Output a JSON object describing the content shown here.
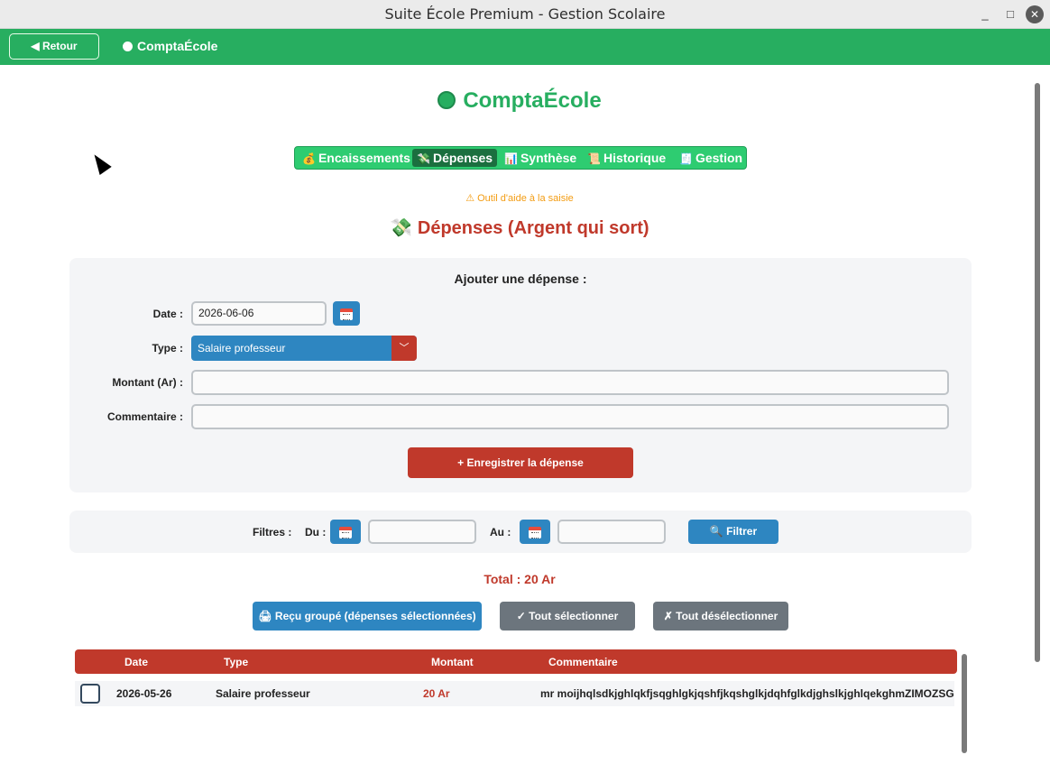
{
  "window": {
    "title": "Suite École Premium - Gestion Scolaire",
    "min": "_",
    "max": "□",
    "close": "✕"
  },
  "appbar": {
    "back_label": "◀ Retour",
    "title": "ComptaÉcole"
  },
  "header": {
    "title": "ComptaÉcole",
    "accent": "#27ae60"
  },
  "tabs": [
    {
      "icon": "💰",
      "label": "Encaissements"
    },
    {
      "icon": "💸",
      "label": "Dépenses",
      "active": true
    },
    {
      "icon": "📊",
      "label": "Synthèse"
    },
    {
      "icon": "📜",
      "label": "Historique"
    },
    {
      "icon": "🧾",
      "label": "Gestion"
    }
  ],
  "warning": "⚠ Outil d'aide à la saisie",
  "section": {
    "icon": "💸",
    "title": "Dépenses (Argent qui sort)"
  },
  "form": {
    "title": "Ajouter une dépense :",
    "date_label": "Date :",
    "date_value": "2026-06-06",
    "type_label": "Type :",
    "type_value": "Salaire professeur",
    "amount_label": "Montant (Ar) :",
    "amount_value": "",
    "comment_label": "Commentaire :",
    "comment_value": "",
    "save_label": "+ Enregistrer la dépense"
  },
  "filters": {
    "label": "Filtres :",
    "from_label": "Du :",
    "from_value": "",
    "to_label": "Au :",
    "to_value": "",
    "button_label": "🔍 Filtrer"
  },
  "total": "Total : 20 Ar",
  "actions": {
    "grouped_receipt": "🖨 Reçu groupé (dépenses sélectionnées)",
    "select_all": "✓ Tout sélectionner",
    "deselect_all": "✗ Tout désélectionner"
  },
  "table": {
    "headers": [
      "Date",
      "Type",
      "Montant",
      "Commentaire"
    ],
    "rows": [
      {
        "date": "2026-05-26",
        "type": "Salaire professeur",
        "amount": "20 Ar",
        "comment": "mr moijhqlsdkjghlqkfjsqghlgkjqshfjkqshglkjdqhfglkdjghslkjghlqekghmZIMOZSGI",
        "checked": false
      }
    ]
  },
  "colors": {
    "green": "#27ae60",
    "red": "#c0392b",
    "blue": "#2e86c1",
    "gray": "#6c757d",
    "orange": "#f39c12"
  }
}
